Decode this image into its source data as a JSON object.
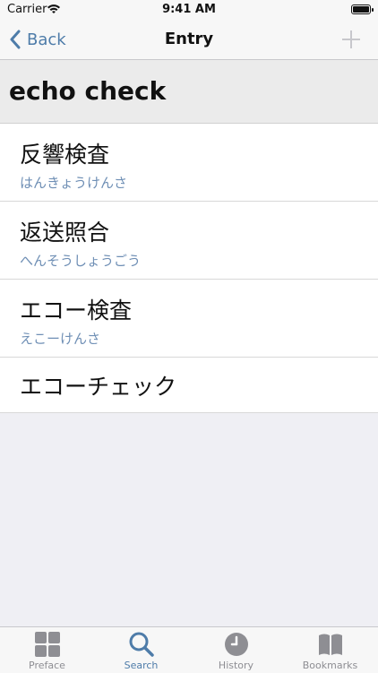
{
  "status_bar": {
    "carrier": "Carrier",
    "time": "9:41 AM"
  },
  "nav": {
    "back_label": "Back",
    "title": "Entry"
  },
  "entry": {
    "term": "echo check"
  },
  "translations": [
    {
      "text": "反響検査",
      "reading": "はんきょうけんさ"
    },
    {
      "text": "返送照合",
      "reading": "へんそうしょうごう"
    },
    {
      "text": "エコー検査",
      "reading": "えこーけんさ"
    },
    {
      "text": "エコーチェック",
      "reading": ""
    }
  ],
  "tabs": [
    {
      "label": "Preface",
      "icon": "grid-icon",
      "active": false
    },
    {
      "label": "Search",
      "icon": "search-icon",
      "active": true
    },
    {
      "label": "History",
      "icon": "clock-icon",
      "active": false
    },
    {
      "label": "Bookmarks",
      "icon": "book-icon",
      "active": false
    }
  ],
  "colors": {
    "accent": "#4e7ca9",
    "reading": "#6f8fb5",
    "inactive": "#8e8e93"
  }
}
